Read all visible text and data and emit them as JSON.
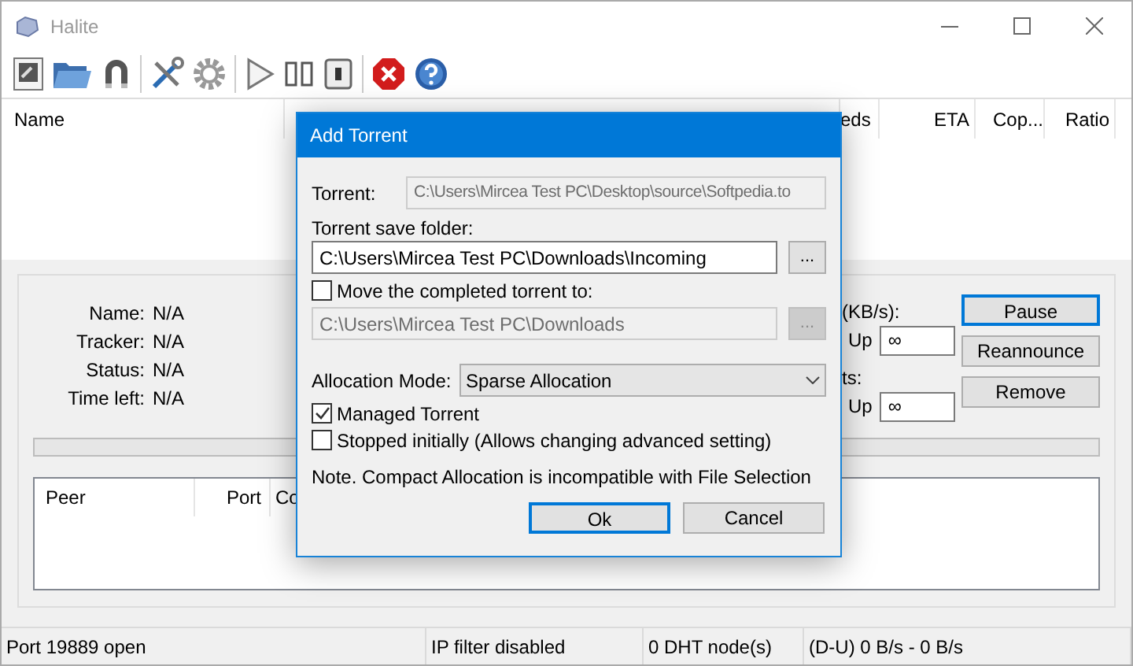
{
  "window": {
    "title": "Halite"
  },
  "torrent_list": {
    "columns": [
      "Name",
      "eds",
      "ETA",
      "Cop...",
      "Ratio"
    ]
  },
  "details": {
    "fields": [
      {
        "label": "Name:",
        "value": "N/A"
      },
      {
        "label": "Tracker:",
        "value": "N/A"
      },
      {
        "label": "Status:",
        "value": "N/A"
      },
      {
        "label": "Time left:",
        "value": "N/A"
      }
    ],
    "rate_label": "(KB/s):",
    "rate_up_label": "Up",
    "rate_up_value": "∞",
    "conn_label": "ts:",
    "conn_up_label": "Up",
    "conn_up_value": "∞",
    "buttons": [
      {
        "label": "Pause",
        "focused": true
      },
      {
        "label": "Reannounce",
        "focused": false
      },
      {
        "label": "Remove",
        "focused": false
      }
    ]
  },
  "progress": {
    "level": 0
  },
  "peers": {
    "columns": [
      "Peer",
      "Port",
      "Co"
    ]
  },
  "status_bar": [
    "Port 19889 open",
    "IP filter disabled",
    "0 DHT node(s)",
    "(D-U) 0 B/s - 0 B/s"
  ],
  "dialog": {
    "title": "Add Torrent",
    "torrent_label": "Torrent:",
    "torrent_field": {
      "value": "C:\\Users\\Mircea Test PC\\Desktop\\source\\Softpedia.to",
      "disabled": true
    },
    "save_label": "Torrent save folder:",
    "save_field": {
      "value": "C:\\Users\\Mircea Test PC\\Downloads\\Incoming",
      "disabled": false
    },
    "save_browse": {
      "label": "...",
      "disabled": false
    },
    "move_checkbox": {
      "label": "Move the completed torrent to:",
      "checked": false
    },
    "move_field": {
      "value": "C:\\Users\\Mircea Test PC\\Downloads",
      "disabled": true
    },
    "move_browse": {
      "label": "...",
      "disabled": true
    },
    "allocation_label": "Allocation Mode:",
    "allocation_value": "Sparse Allocation",
    "checkboxes": [
      {
        "label": "Managed Torrent",
        "checked": true
      },
      {
        "label": "Stopped initially (Allows changing advanced setting)",
        "checked": false
      }
    ],
    "note": "Note. Compact Allocation is incompatible with File Selection",
    "buttons": [
      {
        "label": "Ok",
        "focused": true
      },
      {
        "label": "Cancel",
        "focused": false
      }
    ]
  }
}
